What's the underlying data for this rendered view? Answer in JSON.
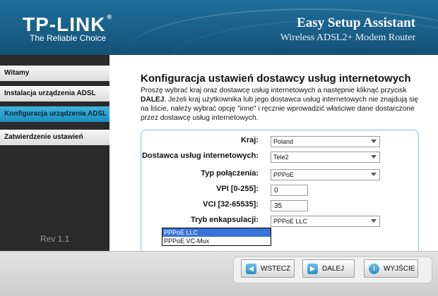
{
  "header": {
    "brand_name": "TP-LINK",
    "brand_mark": "®",
    "tagline": "The Reliable Choice",
    "app_title": "Easy Setup Assistant",
    "app_subtitle": "Wireless ADSL2+ Modem Router"
  },
  "sidebar": {
    "items": [
      {
        "label": "Witamy",
        "active": false
      },
      {
        "label": "Instalacja urządzenia ADSL",
        "active": false
      },
      {
        "label": "Konfiguracja urządzenia ADSL",
        "active": true
      },
      {
        "label": "Zatwierdzenie ustawień",
        "active": false
      }
    ],
    "version": "Rev 1.1"
  },
  "main": {
    "title": "Konfiguracja ustawień dostawcy usług internetowych",
    "description_part1": "Proszę wybrać kraj oraz dostawcę usług internetowych a następnie kliknąć przycisk ",
    "description_bold": "DALEJ",
    "description_part2": ". Jeżeli kraj użytkownika lub jego dostawca usług internetowych nie znajdują się na liście, należy wybrać opcję \"inne\" i ręcznie wprowadzić właściwe dane dostarczone przez dostawcę usług internetowych."
  },
  "form": {
    "country_label": "Kraj:",
    "country_value": "Poland",
    "isp_label": "Dostawca usług internetowych:",
    "isp_value": "Tele2",
    "connection_label": "Typ połączenia:",
    "connection_value": "PPPoE",
    "vpi_label": "VPI [0-255]:",
    "vpi_value": "0",
    "vci_label": "VCI [32-65535]:",
    "vci_value": "35",
    "encap_label": "Tryb enkapsulacji:",
    "encap_value": "PPPoE LLC",
    "encap_options": [
      "PPPoE LLC",
      "PPPoE VC-Mux"
    ]
  },
  "footer": {
    "back_label": "WSTECZ",
    "next_label": "DALEJ",
    "exit_label": "WYJŚCIE"
  },
  "icons": {
    "back": "arrow-left-icon",
    "next": "arrow-right-icon",
    "exit": "info-icon"
  },
  "colors": {
    "header_blue": "#1a5f88",
    "active_item": "#2aa3d3",
    "panel_border": "#7fc1df",
    "selection_blue": "#3874d8"
  }
}
